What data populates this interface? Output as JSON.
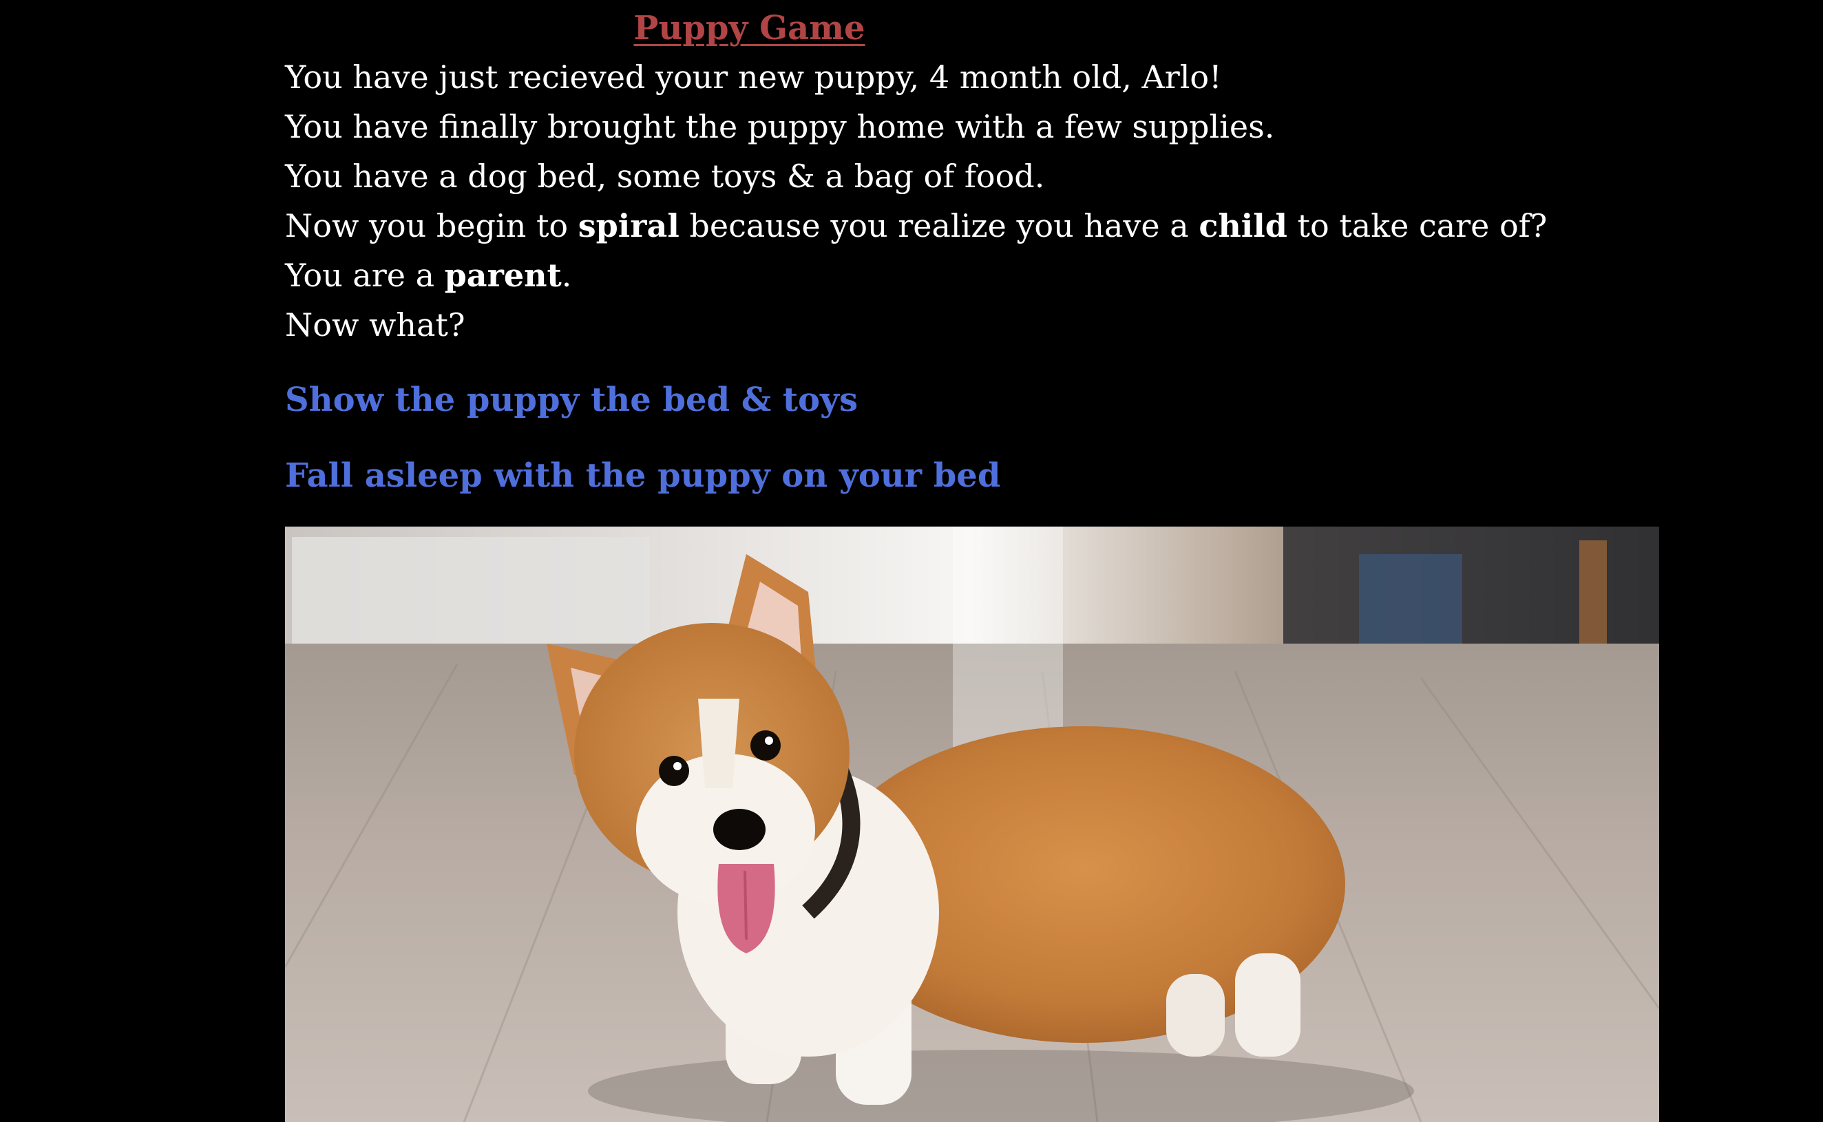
{
  "page": {
    "title": "Puppy Game",
    "title_color": "#b14545",
    "background": "#000000"
  },
  "story": {
    "line1": "You have just recieved your new puppy, 4 month old, Arlo!",
    "line2": "You have finally brought the puppy home with a few supplies.",
    "line3": "You have a dog bed, some toys & a bag of food.",
    "line4_a": "Now you begin to ",
    "line4_b": "spiral",
    "line4_c": " because you realize you have a ",
    "line4_d": "child",
    "line4_e": " to take care of?",
    "line5_a": "You are a ",
    "line5_b": "parent",
    "line5_c": ".",
    "line6": "Now what?"
  },
  "choices": {
    "option1": "Show the puppy the bed & toys",
    "option2": "Fall asleep with the puppy on your bed",
    "link_color": "#4f6fdc"
  },
  "image": {
    "subject": "corgi-puppy-photo"
  }
}
